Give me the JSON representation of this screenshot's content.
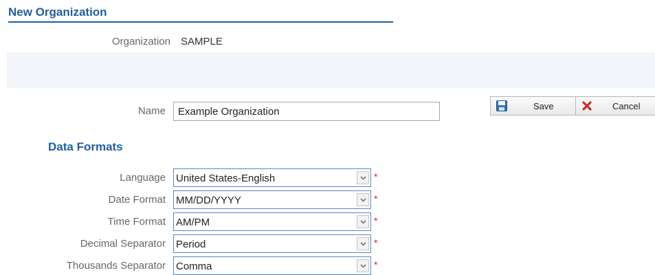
{
  "page": {
    "title": "New Organization"
  },
  "organization": {
    "label": "Organization",
    "value": "SAMPLE"
  },
  "name_field": {
    "label": "Name",
    "value": "Example Organization"
  },
  "toolbar": {
    "save_label": "Save",
    "cancel_label": "Cancel"
  },
  "data_formats": {
    "title": "Data Formats",
    "fields": [
      {
        "label": "Language",
        "value": "United States-English",
        "required": true
      },
      {
        "label": "Date Format",
        "value": "MM/DD/YYYY",
        "required": true
      },
      {
        "label": "Time Format",
        "value": "AM/PM",
        "required": true
      },
      {
        "label": "Decimal Separator",
        "value": "Period",
        "required": true
      },
      {
        "label": "Thousands Separator",
        "value": "Comma",
        "required": true
      }
    ],
    "required_marker": "*"
  },
  "icons": {
    "save": "floppy-disk-icon",
    "cancel": "red-x-icon",
    "dropdown": "chevron-down-icon"
  },
  "colors": {
    "accent": "#1f5f9e",
    "required": "#e02020",
    "band": "#f2f5f9"
  }
}
